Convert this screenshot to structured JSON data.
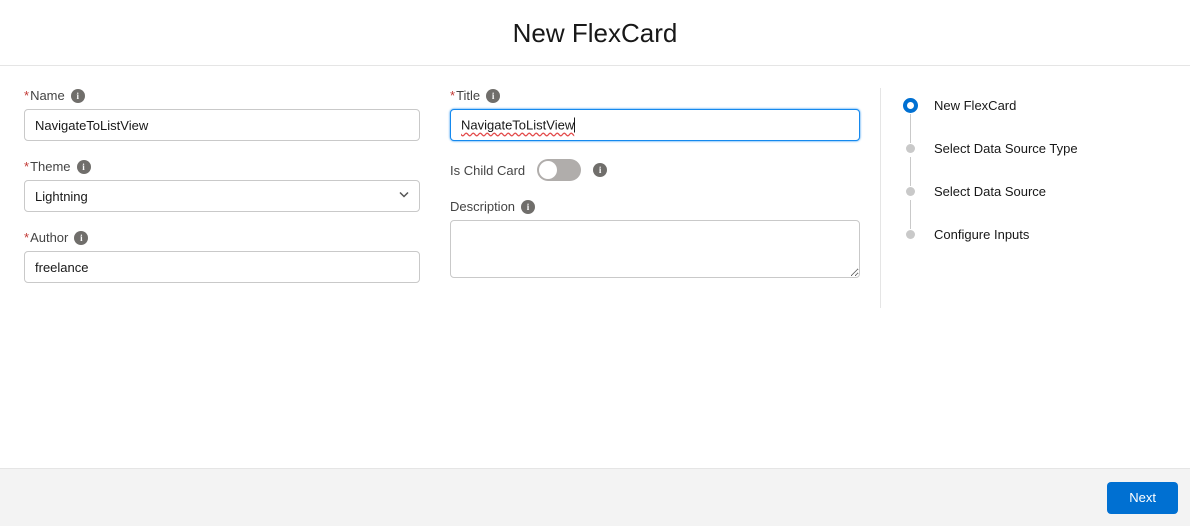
{
  "header": {
    "title": "New FlexCard"
  },
  "form": {
    "name": {
      "label": "Name",
      "value": "NavigateToListView"
    },
    "theme": {
      "label": "Theme",
      "value": "Lightning"
    },
    "author": {
      "label": "Author",
      "value": "freelance"
    },
    "title": {
      "label": "Title",
      "value": "NavigateToListView"
    },
    "is_child_card": {
      "label": "Is Child Card",
      "value": false
    },
    "description": {
      "label": "Description",
      "value": ""
    }
  },
  "stepper": {
    "steps": [
      {
        "label": "New FlexCard",
        "active": true
      },
      {
        "label": "Select Data Source Type",
        "active": false
      },
      {
        "label": "Select Data Source",
        "active": false
      },
      {
        "label": "Configure Inputs",
        "active": false
      }
    ]
  },
  "footer": {
    "next_label": "Next"
  }
}
